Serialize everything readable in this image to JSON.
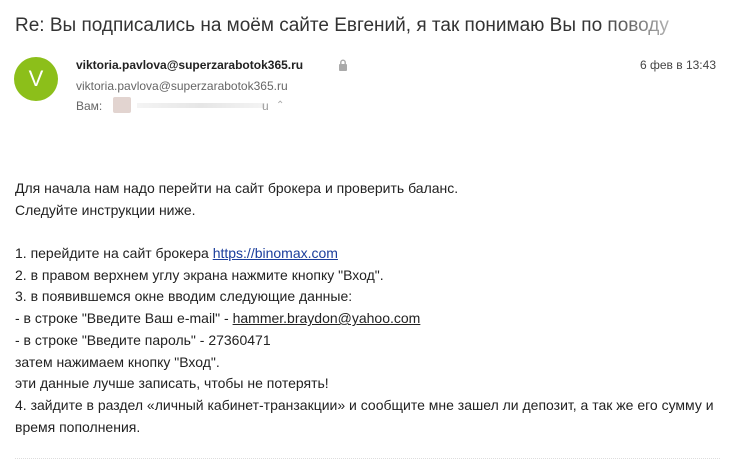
{
  "email": {
    "subject": "Re: Вы подписались на моём сайте Евгений, я так понимаю Вы по поводу",
    "avatar_letter": "V",
    "avatar_color": "#8cbf1a",
    "sender_name": "viktoria.pavlova@superzarabotok365.ru",
    "sender_email": "viktoria.pavlova@superzarabotok365.ru",
    "date": "6 фев в 13:43",
    "to_label": "Вам:",
    "to_redacted_tail": "u"
  },
  "body": {
    "line1": "Для начала нам надо перейти на сайт брокера и проверить баланс.",
    "line2": "Следуйте инструкции ниже.",
    "step1_prefix": "1. перейдите на сайт брокера ",
    "step1_link": "https://binomax.com",
    "step2": "2. в правом верхнем углу экрана нажмите кнопку \"Вход\".",
    "step3": "3. в появившемся окне вводим следующие данные:",
    "email_prefix": "- в строке \"Введите Ваш e-mail\" - ",
    "email_value": "hammer.braydon@yahoo.com",
    "password_line": "- в строке \"Введите пароль\" - 27360471",
    "press_login": "затем нажимаем кнопку \"Вход\".",
    "save_note": "эти данные лучше записать, чтобы не потерять!",
    "step4": "4. зайдите в раздел «личный кабинет-транзакции» и сообщите мне зашел ли депозит, а так же его сумму и время пополнения."
  }
}
